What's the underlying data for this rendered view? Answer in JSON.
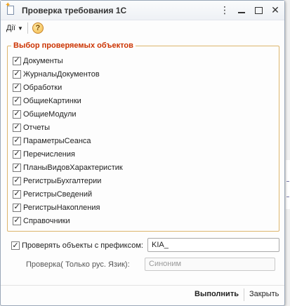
{
  "window": {
    "title": "Проверка требования 1С"
  },
  "toolbar": {
    "actions_label": "Дії",
    "help_glyph": "?"
  },
  "group": {
    "title": "Выбор проверяемых объектов",
    "items": [
      {
        "label": "Документы",
        "checked": true
      },
      {
        "label": "ЖурналыДокументов",
        "checked": true
      },
      {
        "label": "Обработки",
        "checked": true
      },
      {
        "label": "ОбщиеКартинки",
        "checked": true
      },
      {
        "label": "ОбщиеМодули",
        "checked": true
      },
      {
        "label": "Отчеты",
        "checked": true
      },
      {
        "label": "ПараметрыСеанса",
        "checked": true
      },
      {
        "label": "Перечисления",
        "checked": true
      },
      {
        "label": "ПланыВидовХарактеристик",
        "checked": true
      },
      {
        "label": "РегистрыБухгалтерии",
        "checked": true
      },
      {
        "label": "РегистрыСведений",
        "checked": true
      },
      {
        "label": "РегистрыНакопления",
        "checked": true
      },
      {
        "label": "Справочники",
        "checked": true
      }
    ]
  },
  "prefix": {
    "label": "Проверять объекты с префиксом:",
    "checked": true,
    "value": "KIA_"
  },
  "language": {
    "label": "Проверка( Только рус. Язик):",
    "placeholder": "Синоним"
  },
  "footer": {
    "run_label": "Выполнить",
    "close_label": "Закрыть"
  },
  "colors": {
    "group_title": "#cc3300",
    "group_border": "#ddb56c"
  }
}
